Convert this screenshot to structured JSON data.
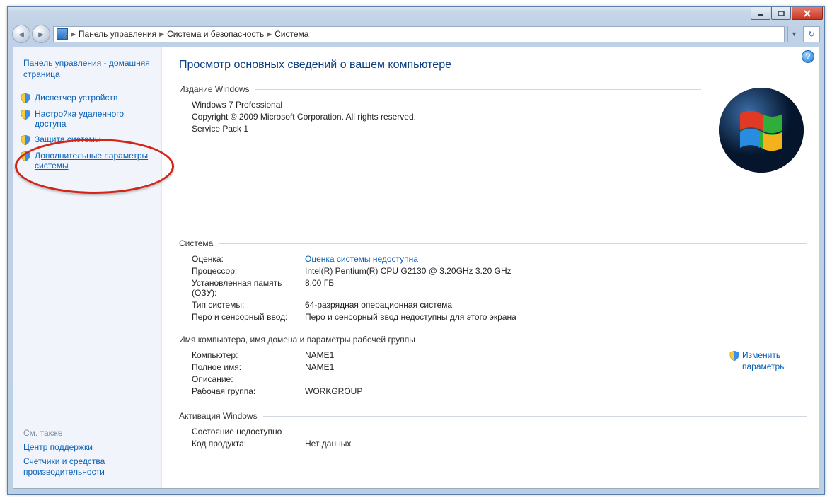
{
  "breadcrumbs": [
    "Панель управления",
    "Система и безопасность",
    "Система"
  ],
  "sidebar": {
    "home_link": "Панель управления - домашняя страница",
    "items": [
      {
        "label": "Диспетчер устройств"
      },
      {
        "label": "Настройка удаленного доступа"
      },
      {
        "label": "Защита системы"
      },
      {
        "label": "Дополнительные параметры системы"
      }
    ],
    "see_also_title": "См. также",
    "see_also": [
      "Центр поддержки",
      "Счетчики и средства производительности"
    ]
  },
  "main": {
    "title": "Просмотр основных сведений о вашем компьютере",
    "edition_section": "Издание Windows",
    "edition_lines": [
      "Windows 7 Professional",
      "Copyright © 2009 Microsoft Corporation.  All rights reserved.",
      "Service Pack 1"
    ],
    "system_section": "Система",
    "system_rows": [
      {
        "k": "Оценка:",
        "v": "Оценка системы недоступна",
        "link": true
      },
      {
        "k": "Процессор:",
        "v": "Intel(R) Pentium(R) CPU G2130 @ 3.20GHz   3.20 GHz"
      },
      {
        "k": "Установленная память (ОЗУ):",
        "v": "8,00 ГБ"
      },
      {
        "k": "Тип системы:",
        "v": "64-разрядная операционная система"
      },
      {
        "k": "Перо и сенсорный ввод:",
        "v": "Перо и сенсорный ввод недоступны для этого экрана"
      }
    ],
    "domain_section": "Имя компьютера, имя домена и параметры рабочей группы",
    "domain_rows": [
      {
        "k": "Компьютер:",
        "v": "NAME1"
      },
      {
        "k": "Полное имя:",
        "v": "NAME1"
      },
      {
        "k": "Описание:",
        "v": ""
      },
      {
        "k": "Рабочая группа:",
        "v": "WORKGROUP"
      }
    ],
    "change_settings": "Изменить параметры",
    "activation_section": "Активация Windows",
    "activation_rows": [
      {
        "k": "",
        "v": "Состояние недоступно"
      },
      {
        "k": "Код продукта:",
        "v": "Нет данных"
      }
    ]
  }
}
